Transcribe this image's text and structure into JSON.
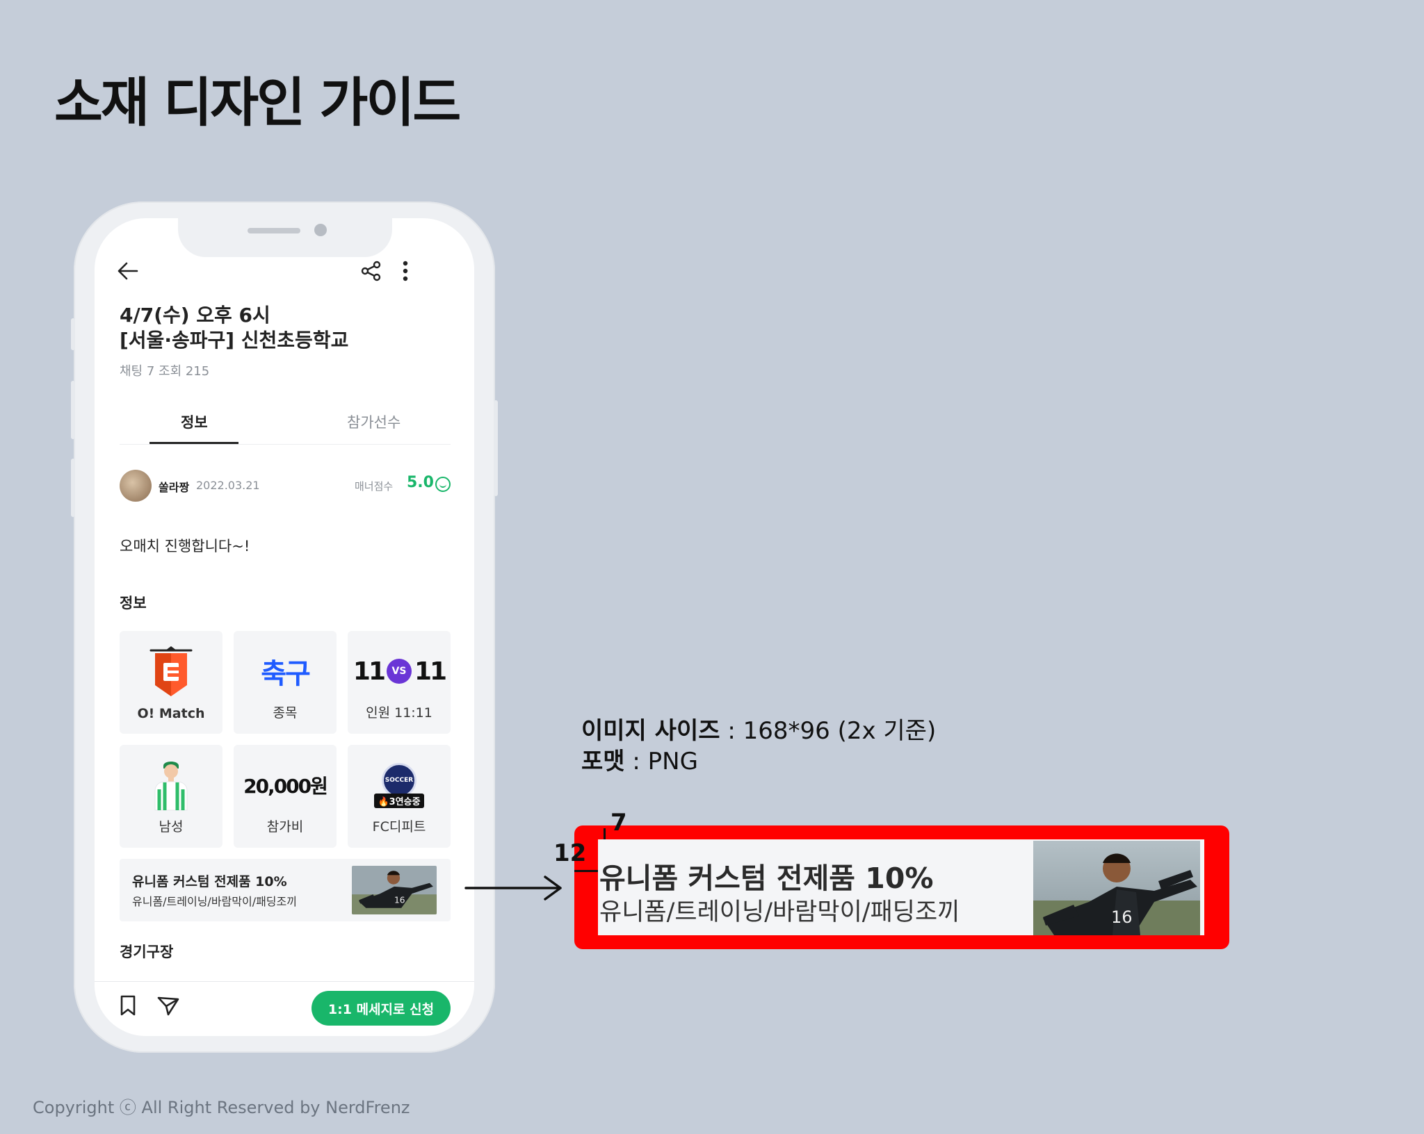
{
  "page": {
    "title": "소재 디자인 가이드",
    "copyright": "Copyright ⓒ All Right Reserved by NerdFrenz"
  },
  "phone": {
    "header": {
      "back_icon": "arrow-left-icon",
      "share_icon": "share-icon",
      "more_icon": "more-vertical-icon"
    },
    "event": {
      "title_line1": "4/7(수) 오후 6시",
      "title_line2": "[서울·송파구] 신천초등학교",
      "meta": "채팅 7  조회 215"
    },
    "tabs": [
      {
        "label": "정보",
        "active": true
      },
      {
        "label": "참가선수",
        "active": false
      }
    ],
    "author": {
      "name": "쏠라짱",
      "date": "2022.03.21",
      "manner_label": "매너점수",
      "manner_score": "5.0"
    },
    "body_text": "오매치 진행합니다~!",
    "info_label": "정보",
    "info_cells": [
      {
        "caption": "O! Match",
        "icon": "omatch-logo"
      },
      {
        "caption": "종목",
        "art_text": "축구"
      },
      {
        "caption": "인원 11:11",
        "art_left": "11",
        "art_vs": "VS",
        "art_right": "11"
      },
      {
        "caption": "남성",
        "icon": "male-player-icon"
      },
      {
        "caption": "참가비",
        "art_text": "20,000원"
      },
      {
        "caption": "FC디피트",
        "badge_logo_text": "SOCCER",
        "badge_text": "🔥3연승중"
      }
    ],
    "ad_banner": {
      "title": "유니폼 커스텀 전제품 10%",
      "subtitle": "유니폼/트레이닝/바람막이/패딩조끼",
      "image": "soccer-player-photo"
    },
    "field_label": "경기구장",
    "bottom_bar": {
      "bookmark_icon": "bookmark-icon",
      "send_icon": "send-icon",
      "cta_label": "1:1 메세지로 신청"
    }
  },
  "spec": {
    "size_label": "이미지 사이즈",
    "size_value": " : 168*96 (2x 기준)",
    "format_label": "포맷",
    "format_value": " : PNG",
    "dim_top": "7",
    "dim_left": "12"
  },
  "colors": {
    "accent": "#19b66a",
    "highlight_frame": "#ff0000",
    "background": "#c5cdd9",
    "sport_blue": "#1f5bff"
  }
}
